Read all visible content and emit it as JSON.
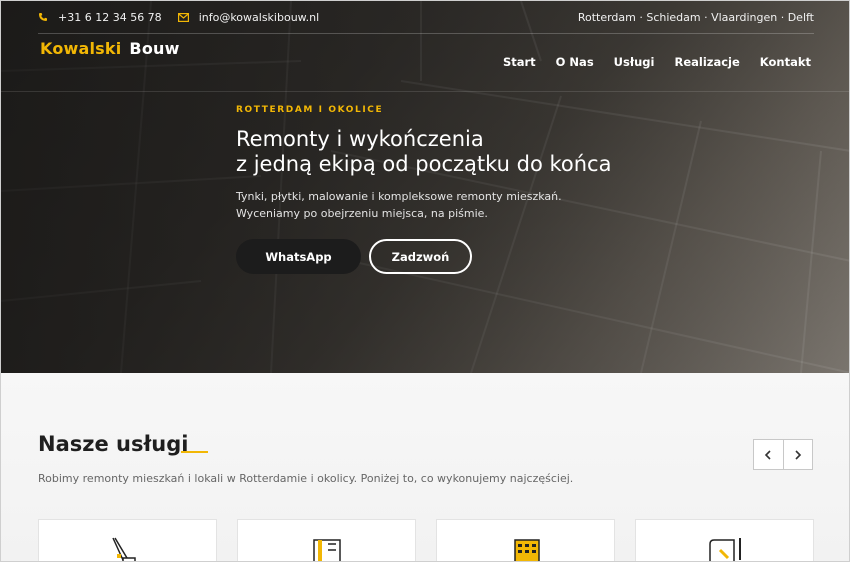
{
  "topbar": {
    "phone": "+31 6 12 34 56 78",
    "email": "info@kowalskibouw.nl",
    "cities": "Rotterdam · Schiedam · Vlaardingen · Delft"
  },
  "brand": {
    "part1": "Kowalski",
    "part2": "Bouw"
  },
  "nav": {
    "items": [
      "Start",
      "O Nas",
      "Usługi",
      "Realizacje",
      "Kontakt"
    ]
  },
  "hero": {
    "eyebrow": "ROTTERDAM I OKOLICE",
    "title_line1": "Remonty i wykończenia",
    "title_line2": "z jedną ekipą od początku do końca",
    "lead_line1": "Tynki, płytki, malowanie i kompleksowe remonty mieszkań.",
    "lead_line2": "Wyceniamy po obejrzeniu miejsca, na piśmie.",
    "btn_whatsapp": "WhatsApp",
    "btn_call": "Zadzwoń"
  },
  "services": {
    "title": "Nasze usługi",
    "subtitle": "Robimy remonty mieszkań i lokali w Rotterdamie i okolicy. Poniżej to, co wykonujemy najczęściej.",
    "prev_icon": "chevron-left-icon",
    "next_icon": "chevron-right-icon",
    "cards": [
      {
        "icon": "crane-icon"
      },
      {
        "icon": "blueprint-icon"
      },
      {
        "icon": "building-icon"
      },
      {
        "icon": "plans-pencil-icon"
      }
    ]
  },
  "colors": {
    "accent": "#f2b705",
    "dark": "#1c1c1c"
  },
  "icons": {
    "phone": "phone-icon",
    "email": "envelope-icon"
  }
}
